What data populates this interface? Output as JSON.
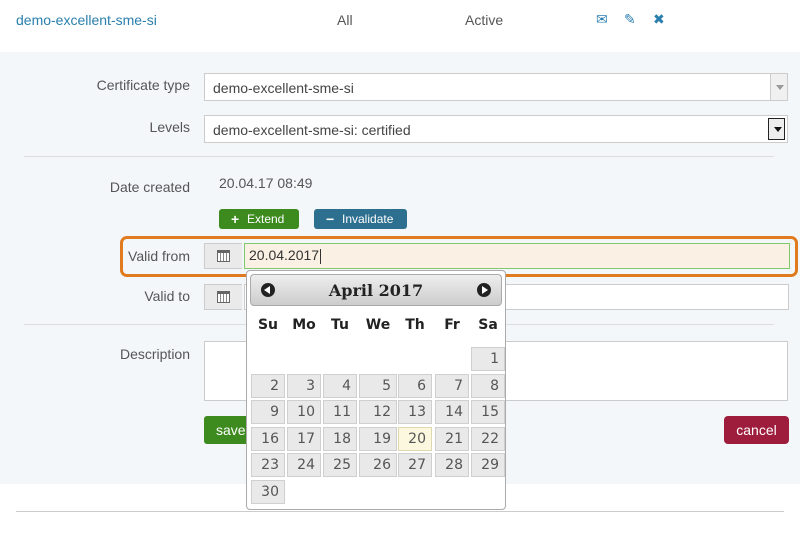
{
  "row": {
    "name": "demo-excellent-sme-si",
    "scope": "All",
    "status": "Active",
    "actions": [
      {
        "name": "mail-icon",
        "glyph": "✉"
      },
      {
        "name": "edit-icon",
        "glyph": "✎"
      },
      {
        "name": "delete-icon",
        "glyph": "✖"
      }
    ]
  },
  "form": {
    "certificate_type": {
      "label": "Certificate type",
      "value": "demo-excellent-sme-si"
    },
    "levels": {
      "label": "Levels",
      "value": "demo-excellent-sme-si: certified"
    },
    "date_created": {
      "label": "Date created",
      "value": "20.04.17 08:49"
    },
    "extend_label": "Extend",
    "invalidate_label": "Invalidate",
    "valid_from": {
      "label": "Valid from",
      "value": "20.04.2017"
    },
    "valid_to": {
      "label": "Valid to",
      "value": ""
    },
    "description": {
      "label": "Description",
      "value": ""
    },
    "save_label": "save",
    "cancel_label": "cancel"
  },
  "datepicker": {
    "title": "April 2017",
    "weekdays": [
      "Su",
      "Mo",
      "Tu",
      "We",
      "Th",
      "Fr",
      "Sa"
    ],
    "first_weekday_index": 6,
    "days_in_month": 30,
    "today": 20
  },
  "colors": {
    "link": "#2a7fae",
    "highlight_border": "#e07b1f",
    "extend": "#3d8a1f",
    "invalidate": "#2c6f8f",
    "cancel": "#9e1d3d"
  }
}
